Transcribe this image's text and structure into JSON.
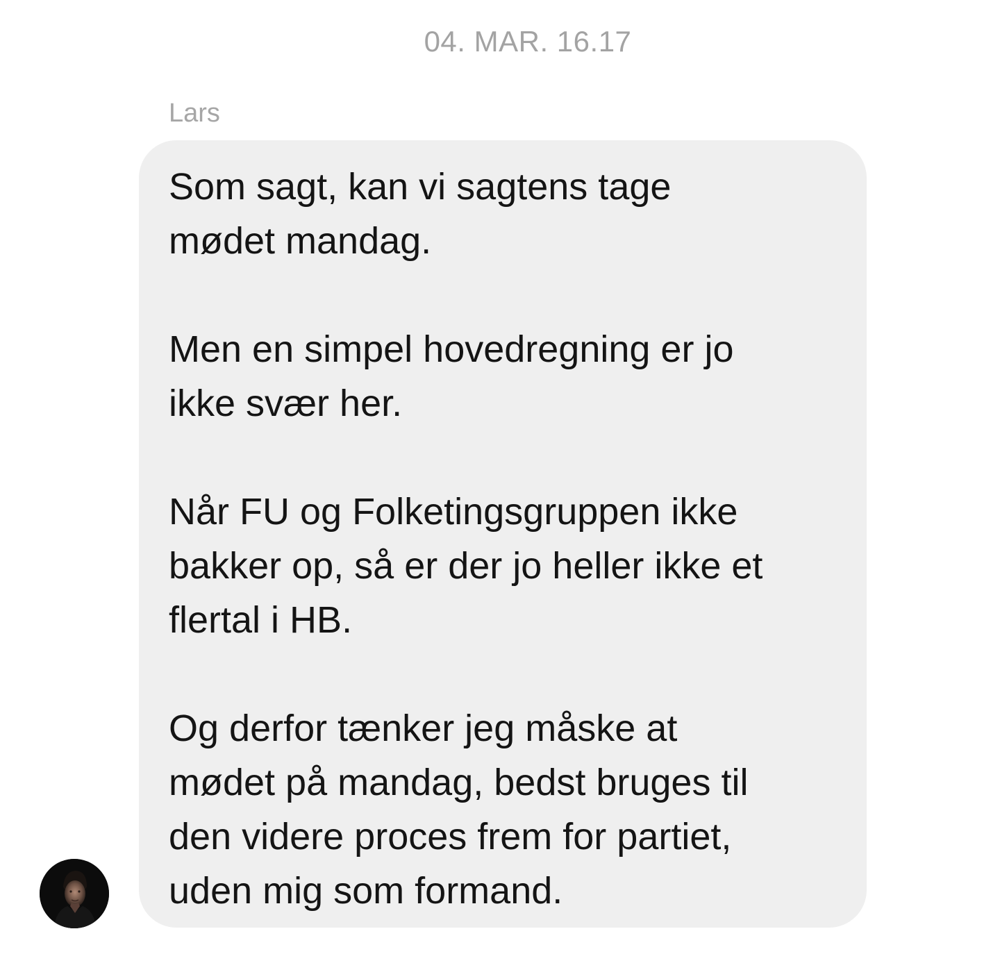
{
  "conversation": {
    "timestamp": "04. MAR. 16.17",
    "message": {
      "sender": "Lars",
      "paragraphs": [
        [
          "Som sagt, kan vi sagtens tage",
          "mødet mandag."
        ],
        [
          "Men en simpel hovedregning er jo",
          "ikke svær her."
        ],
        [
          "Når FU og Folketingsgruppen ikke",
          "bakker op, så er der jo heller ikke et",
          "flertal i HB."
        ],
        [
          "Og derfor tænker jeg måske at",
          "mødet på mandag, bedst bruges til",
          "den videre proces frem for partiet,",
          "uden mig som formand."
        ]
      ],
      "avatar_icon": "person-photo-icon"
    }
  }
}
